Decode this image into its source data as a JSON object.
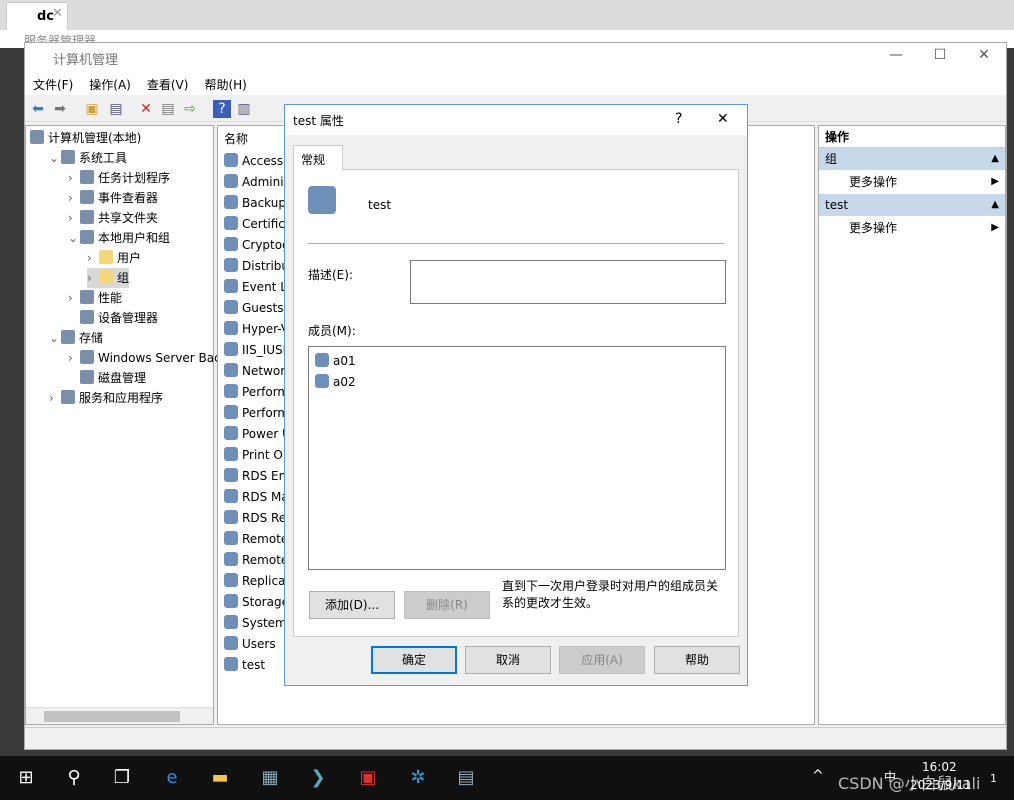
{
  "browser": {
    "tab": "dc",
    "behind_title": "服务器管理器"
  },
  "window": {
    "title": "计算机管理",
    "menu": [
      "文件(F)",
      "操作(A)",
      "查看(V)",
      "帮助(H)"
    ]
  },
  "tree": [
    {
      "label": "计算机管理(本地)",
      "level": 0
    },
    {
      "label": "系统工具",
      "level": 1,
      "open": true
    },
    {
      "label": "任务计划程序",
      "level": 2
    },
    {
      "label": "事件查看器",
      "level": 2
    },
    {
      "label": "共享文件夹",
      "level": 2
    },
    {
      "label": "本地用户和组",
      "level": 2,
      "open": true
    },
    {
      "label": "用户",
      "level": 3,
      "folder": true
    },
    {
      "label": "组",
      "level": 3,
      "folder": true,
      "selected": true
    },
    {
      "label": "性能",
      "level": 2
    },
    {
      "label": "设备管理器",
      "level": 2,
      "noarrow": true
    },
    {
      "label": "存储",
      "level": 1,
      "open": true
    },
    {
      "label": "Windows Server Back",
      "level": 2
    },
    {
      "label": "磁盘管理",
      "level": 2,
      "noarrow": true
    },
    {
      "label": "服务和应用程序",
      "level": 1
    }
  ],
  "list": {
    "header": "名称",
    "items": [
      "Access",
      "Adminis",
      "Backup",
      "Certifica",
      "Cryptog",
      "Distribu",
      "Event Lo",
      "Guests",
      "Hyper-V",
      "IIS_IUSR",
      "Networ",
      "Perform",
      "Perform",
      "Power U",
      "Print Op",
      "RDS En",
      "RDS Ma",
      "RDS Re",
      "Remote",
      "Remote",
      "Replica",
      "Storage",
      "System",
      "Users",
      "test"
    ]
  },
  "actions": {
    "header": "操作",
    "groups": [
      {
        "name": "组",
        "item": "更多操作"
      },
      {
        "name": "test",
        "item": "更多操作"
      }
    ]
  },
  "dialog": {
    "title": "test 属性",
    "help": "?",
    "close": "✕",
    "tab": "常规",
    "group_name": "test",
    "desc_label": "描述(E):",
    "desc_value": "",
    "members_label": "成员(M):",
    "members": [
      "a01",
      "a02"
    ],
    "add": "添加(D)...",
    "remove": "删除(R)",
    "note": "直到下一次用户登录时对用户的组成员关系的更改才生效。",
    "ok": "确定",
    "cancel": "取消",
    "apply": "应用(A)",
    "helpbtn": "帮助"
  },
  "taskbar": {
    "time": "16:02",
    "date": "2023/9/11",
    "ime": "中",
    "notif": "1",
    "watermark": "CSDN @小白鼠kali"
  }
}
